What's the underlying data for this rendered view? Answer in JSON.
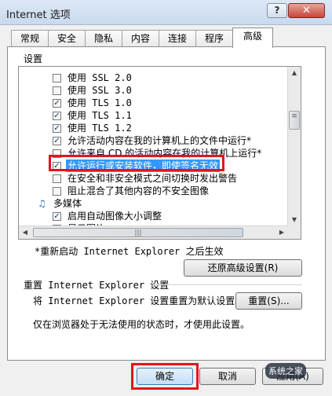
{
  "window": {
    "title": "Internet 选项",
    "help_label": "?",
    "close_label": "✕"
  },
  "tabs": [
    {
      "label": "常规"
    },
    {
      "label": "安全"
    },
    {
      "label": "隐私"
    },
    {
      "label": "内容"
    },
    {
      "label": "连接"
    },
    {
      "label": "程序"
    },
    {
      "label": "高级"
    }
  ],
  "active_tab": "高级",
  "settings": {
    "label": "设置",
    "items": [
      {
        "text": "使用 SSL 2.0",
        "checked": false
      },
      {
        "text": "使用 SSL 3.0",
        "checked": false
      },
      {
        "text": "使用 TLS 1.0",
        "checked": true
      },
      {
        "text": "使用 TLS 1.1",
        "checked": true
      },
      {
        "text": "使用 TLS 1.2",
        "checked": true
      },
      {
        "text": "允许活动内容在我的计算机上的文件中运行*",
        "checked": true
      },
      {
        "text": "允许来自 CD 的活动内容在我的计算机上运行*",
        "checked": false
      },
      {
        "text": "允许运行或安装软件，即使签名无效",
        "checked": true,
        "highlighted": true
      },
      {
        "text": "在安全和非安全模式之间切换时发出警告",
        "checked": false
      },
      {
        "text": "阻止混合了其他内容的不安全图像",
        "checked": false
      }
    ],
    "multimedia": {
      "label": "多媒体",
      "icon": "multimedia-icon",
      "items": [
        {
          "text": "启用自动图像大小调整",
          "checked": true
        },
        {
          "text": "显示图片",
          "checked": true
        }
      ]
    },
    "scroll_grip": "|||"
  },
  "restart_note": "*重新启动 Internet Explorer 之后生效",
  "restore_button": "还原高级设置(R)",
  "reset_section": {
    "heading": "重置 Internet Explorer 设置",
    "description": "将 Internet Explorer 设置重置为默认设置。",
    "button": "重置(S)...",
    "note": "仅在浏览器处于无法使用的状态时，才使用此设置。"
  },
  "footer": {
    "ok": "确定",
    "cancel": "取消",
    "apply": "应用(A)"
  },
  "watermark": "系统之家",
  "colors": {
    "highlight_box": "#e3141e",
    "selection": "#3399ff"
  }
}
